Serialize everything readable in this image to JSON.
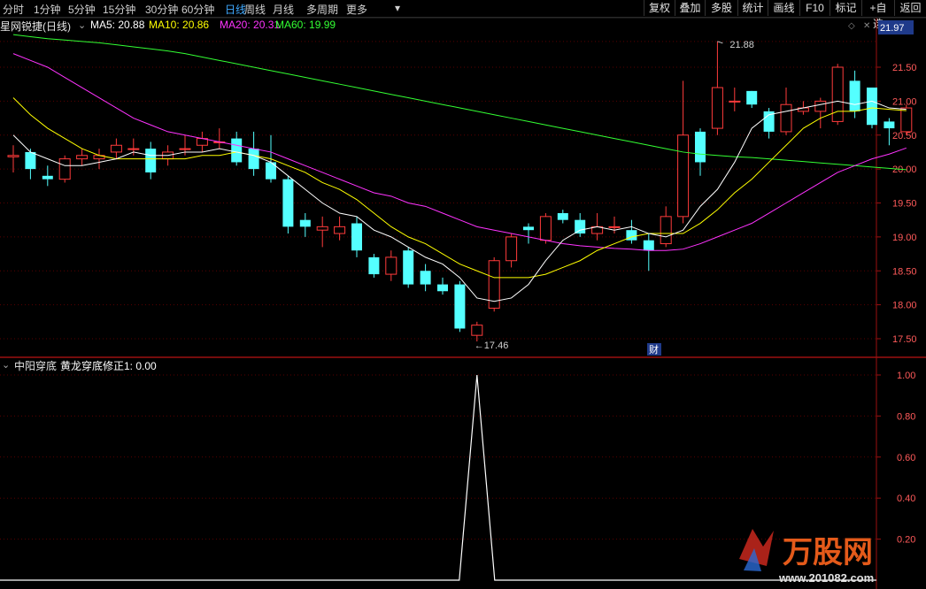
{
  "toolbar": {
    "periods": [
      "分时",
      "1分钟",
      "5分钟",
      "15分钟",
      "30分钟",
      "60分钟",
      "日线",
      "周线",
      "月线",
      "多周期",
      "更多"
    ],
    "active_period": "日线",
    "right_buttons": [
      "复权",
      "叠加",
      "多股",
      "统计",
      "画线",
      "F10",
      "标记",
      "+自选",
      "返回"
    ]
  },
  "main_chart": {
    "title": "星网锐捷(日线)",
    "ma_legend": [
      {
        "label": "MA5: 20.88",
        "color": "#ffffff"
      },
      {
        "label": "MA10: 20.86",
        "color": "#ffff00"
      },
      {
        "label": "MA20: 20.31",
        "color": "#ff33ff"
      },
      {
        "label": "MA60: 19.99",
        "color": "#33ff33"
      }
    ],
    "price_badge": "21.97",
    "marker_high": "21.88",
    "marker_low": "17.46",
    "event_tag": "财"
  },
  "sub_chart": {
    "indicator_name": "中阳穿底",
    "series_label": "黄龙穿底修正1: 0.00"
  },
  "watermark": {
    "brand": "万股网",
    "url": "www.201082.com"
  },
  "colors": {
    "up": "#ff3b3b",
    "down": "#54ffff",
    "ma5": "#ffffff",
    "ma10": "#ffff00",
    "ma20": "#ff33ff",
    "ma60": "#33ff33",
    "axis": "#9b1010",
    "grid": "#5a0000"
  },
  "chart_data": [
    {
      "type": "candlestick",
      "y_ticks": [
        "21.50",
        "21.00",
        "20.50",
        "20.00",
        "19.50",
        "19.00",
        "18.50",
        "18.00",
        "17.50"
      ],
      "ylim": [
        17.3,
        21.97
      ],
      "candles": [
        [
          20.18,
          20.2,
          20.35,
          19.95
        ],
        [
          20.25,
          20.0,
          20.3,
          19.85
        ],
        [
          19.9,
          19.85,
          20.05,
          19.75
        ],
        [
          19.85,
          20.15,
          20.2,
          19.8
        ],
        [
          20.15,
          20.2,
          20.3,
          20.05
        ],
        [
          20.15,
          20.2,
          20.3,
          20.0
        ],
        [
          20.25,
          20.35,
          20.45,
          20.15
        ],
        [
          20.3,
          20.3,
          20.45,
          20.2
        ],
        [
          20.3,
          19.95,
          20.4,
          19.85
        ],
        [
          20.15,
          20.25,
          20.35,
          20.05
        ],
        [
          20.3,
          20.3,
          20.5,
          20.2
        ],
        [
          20.35,
          20.45,
          20.55,
          20.25
        ],
        [
          20.4,
          20.4,
          20.6,
          20.3
        ],
        [
          20.45,
          20.1,
          20.55,
          20.05
        ],
        [
          20.3,
          20.0,
          20.55,
          19.9
        ],
        [
          20.1,
          19.85,
          20.5,
          19.8
        ],
        [
          19.85,
          19.15,
          19.9,
          19.05
        ],
        [
          19.25,
          19.15,
          19.35,
          19.0
        ],
        [
          19.1,
          19.15,
          19.3,
          18.85
        ],
        [
          19.05,
          19.15,
          19.3,
          18.95
        ],
        [
          19.2,
          18.8,
          19.3,
          18.7
        ],
        [
          18.7,
          18.45,
          18.75,
          18.4
        ],
        [
          18.45,
          18.7,
          18.8,
          18.35
        ],
        [
          18.8,
          18.3,
          18.85,
          18.25
        ],
        [
          18.5,
          18.3,
          18.6,
          18.2
        ],
        [
          18.3,
          18.2,
          18.4,
          18.15
        ],
        [
          18.3,
          17.65,
          18.35,
          17.6
        ],
        [
          17.55,
          17.7,
          17.75,
          17.46
        ],
        [
          17.95,
          18.65,
          18.7,
          17.9
        ],
        [
          18.65,
          19.0,
          19.05,
          18.55
        ],
        [
          19.15,
          19.1,
          19.2,
          18.9
        ],
        [
          18.95,
          19.3,
          19.35,
          18.9
        ],
        [
          19.35,
          19.25,
          19.4,
          19.2
        ],
        [
          19.25,
          19.05,
          19.35,
          19.0
        ],
        [
          19.05,
          19.15,
          19.35,
          18.95
        ],
        [
          19.15,
          19.15,
          19.3,
          19.05
        ],
        [
          19.1,
          18.95,
          19.25,
          18.9
        ],
        [
          18.95,
          18.8,
          19.05,
          18.5
        ],
        [
          18.9,
          19.3,
          19.45,
          18.85
        ],
        [
          19.3,
          20.5,
          21.3,
          19.2
        ],
        [
          20.55,
          20.1,
          20.6,
          19.9
        ],
        [
          20.6,
          21.2,
          21.88,
          20.5
        ],
        [
          21.0,
          21.0,
          21.2,
          20.85
        ],
        [
          21.15,
          20.95,
          21.15,
          20.9
        ],
        [
          20.85,
          20.55,
          20.9,
          20.45
        ],
        [
          20.55,
          20.95,
          21.2,
          20.5
        ],
        [
          20.85,
          20.9,
          21.0,
          20.8
        ],
        [
          20.85,
          21.0,
          21.05,
          20.6
        ],
        [
          20.7,
          21.5,
          21.55,
          20.65
        ],
        [
          21.3,
          20.85,
          21.45,
          20.75
        ],
        [
          21.2,
          20.65,
          21.2,
          20.6
        ],
        [
          20.7,
          20.6,
          20.75,
          20.35
        ],
        [
          20.55,
          20.9,
          20.95,
          20.5
        ]
      ],
      "ma5": [
        20.5,
        20.25,
        20.15,
        20.05,
        20.05,
        20.1,
        20.15,
        20.25,
        20.2,
        20.2,
        20.25,
        20.25,
        20.3,
        20.25,
        20.2,
        20.1,
        19.9,
        19.7,
        19.5,
        19.35,
        19.3,
        19.1,
        19.0,
        18.85,
        18.7,
        18.6,
        18.4,
        18.1,
        18.05,
        18.1,
        18.3,
        18.65,
        18.95,
        19.1,
        19.15,
        19.1,
        19.15,
        19.05,
        19.0,
        19.1,
        19.45,
        19.7,
        20.1,
        20.6,
        20.8,
        20.85,
        20.9,
        20.95,
        21.0,
        20.95,
        21.0,
        20.9,
        20.88
      ],
      "ma10": [
        21.05,
        20.8,
        20.6,
        20.45,
        20.3,
        20.2,
        20.15,
        20.15,
        20.15,
        20.15,
        20.15,
        20.2,
        20.2,
        20.25,
        20.2,
        20.15,
        20.05,
        19.95,
        19.8,
        19.7,
        19.55,
        19.35,
        19.15,
        19.0,
        18.9,
        18.75,
        18.6,
        18.5,
        18.4,
        18.4,
        18.4,
        18.45,
        18.55,
        18.65,
        18.8,
        18.9,
        19.0,
        19.05,
        19.05,
        19.05,
        19.2,
        19.4,
        19.65,
        19.85,
        20.1,
        20.35,
        20.6,
        20.75,
        20.85,
        20.85,
        20.9,
        20.88,
        20.86
      ],
      "ma20": [
        21.7,
        21.6,
        21.5,
        21.35,
        21.2,
        21.05,
        20.9,
        20.75,
        20.65,
        20.55,
        20.5,
        20.45,
        20.4,
        20.35,
        20.3,
        20.25,
        20.15,
        20.05,
        19.95,
        19.85,
        19.75,
        19.65,
        19.6,
        19.5,
        19.45,
        19.35,
        19.25,
        19.15,
        19.1,
        19.05,
        19.0,
        18.95,
        18.9,
        18.87,
        18.85,
        18.83,
        18.82,
        18.8,
        18.8,
        18.82,
        18.9,
        19.0,
        19.1,
        19.2,
        19.35,
        19.5,
        19.65,
        19.8,
        19.95,
        20.05,
        20.15,
        20.22,
        20.31
      ],
      "ma60": [
        21.98,
        21.95,
        21.92,
        21.9,
        21.88,
        21.86,
        21.83,
        21.8,
        21.77,
        21.74,
        21.7,
        21.65,
        21.6,
        21.55,
        21.5,
        21.45,
        21.4,
        21.35,
        21.3,
        21.25,
        21.2,
        21.15,
        21.1,
        21.05,
        21.0,
        20.95,
        20.9,
        20.85,
        20.8,
        20.75,
        20.7,
        20.65,
        20.6,
        20.55,
        20.5,
        20.45,
        20.4,
        20.35,
        20.3,
        20.25,
        20.22,
        20.2,
        20.18,
        20.17,
        20.15,
        20.13,
        20.11,
        20.09,
        20.07,
        20.05,
        20.03,
        20.01,
        19.99
      ]
    },
    {
      "type": "line",
      "name": "黄龙穿底修正1",
      "y_ticks": [
        "1.00",
        "0.80",
        "0.60",
        "0.40",
        "0.20"
      ],
      "ylim": [
        0,
        1.0
      ],
      "spike_index": 27,
      "spike_value": 1.0
    }
  ]
}
